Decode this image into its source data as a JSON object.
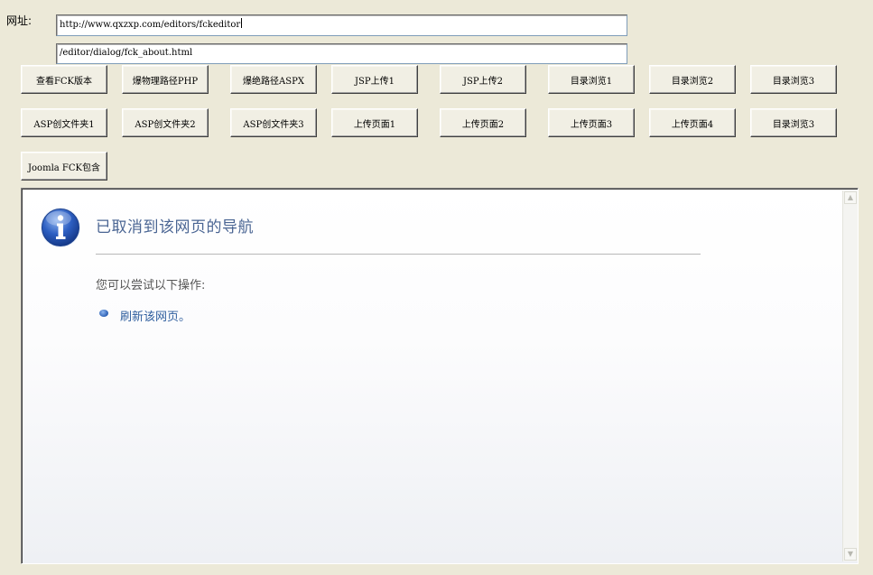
{
  "address": {
    "label": "网址:",
    "url_value": "http://www.qxzxp.com/editors/fckeditor",
    "path_value": "/editor/dialog/fck_about.html"
  },
  "buttons_row1": [
    "查看FCK版本",
    "爆物理路径PHP",
    "爆绝路径ASPX",
    "JSP上传1",
    "JSP上传2",
    "目录浏览1",
    "目录浏览2",
    "目录浏览3"
  ],
  "buttons_row2": [
    "ASP创文件夹1",
    "ASP创文件夹2",
    "ASP创文件夹3",
    "上传页面1",
    "上传页面2",
    "上传页面3",
    "上传页面4",
    "目录浏览3"
  ],
  "buttons_row3": [
    "Joomla FCK包含"
  ],
  "browser": {
    "title": "已取消到该网页的导航",
    "try_text": "您可以尝试以下操作:",
    "refresh_link": "刷新该网页。",
    "icon": "info-icon"
  },
  "colors": {
    "title": "#4a6593",
    "link": "#2f5e9e",
    "background": "#ece9d8"
  }
}
